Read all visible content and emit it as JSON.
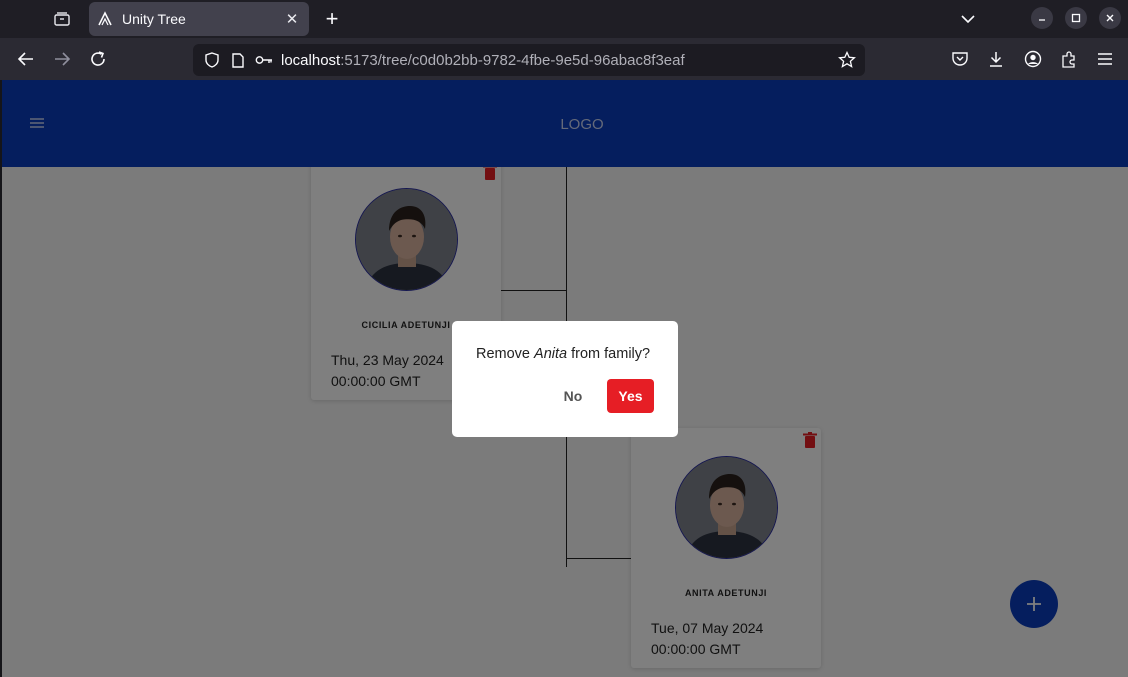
{
  "browser": {
    "tab_title": "Unity Tree",
    "url_host": "localhost",
    "url_path": ":5173/tree/c0d0b2bb-9782-4fbe-9e5d-96abac8f3eaf"
  },
  "app": {
    "logo": "LOGO"
  },
  "members": [
    {
      "name": "CICILIA ADETUNJI",
      "date_line1": "Thu, 23 May 2024",
      "date_line2": "00:00:00 GMT"
    },
    {
      "name": "ANITA ADETUNJI",
      "date_line1": "Tue, 07 May 2024",
      "date_line2": "00:00:00 GMT"
    }
  ],
  "dialog": {
    "prefix": "Remove ",
    "name": "Anita",
    "suffix": " from family?",
    "no_label": "No",
    "yes_label": "Yes"
  },
  "colors": {
    "primary": "#0a3dbd",
    "danger": "#e61e25"
  }
}
